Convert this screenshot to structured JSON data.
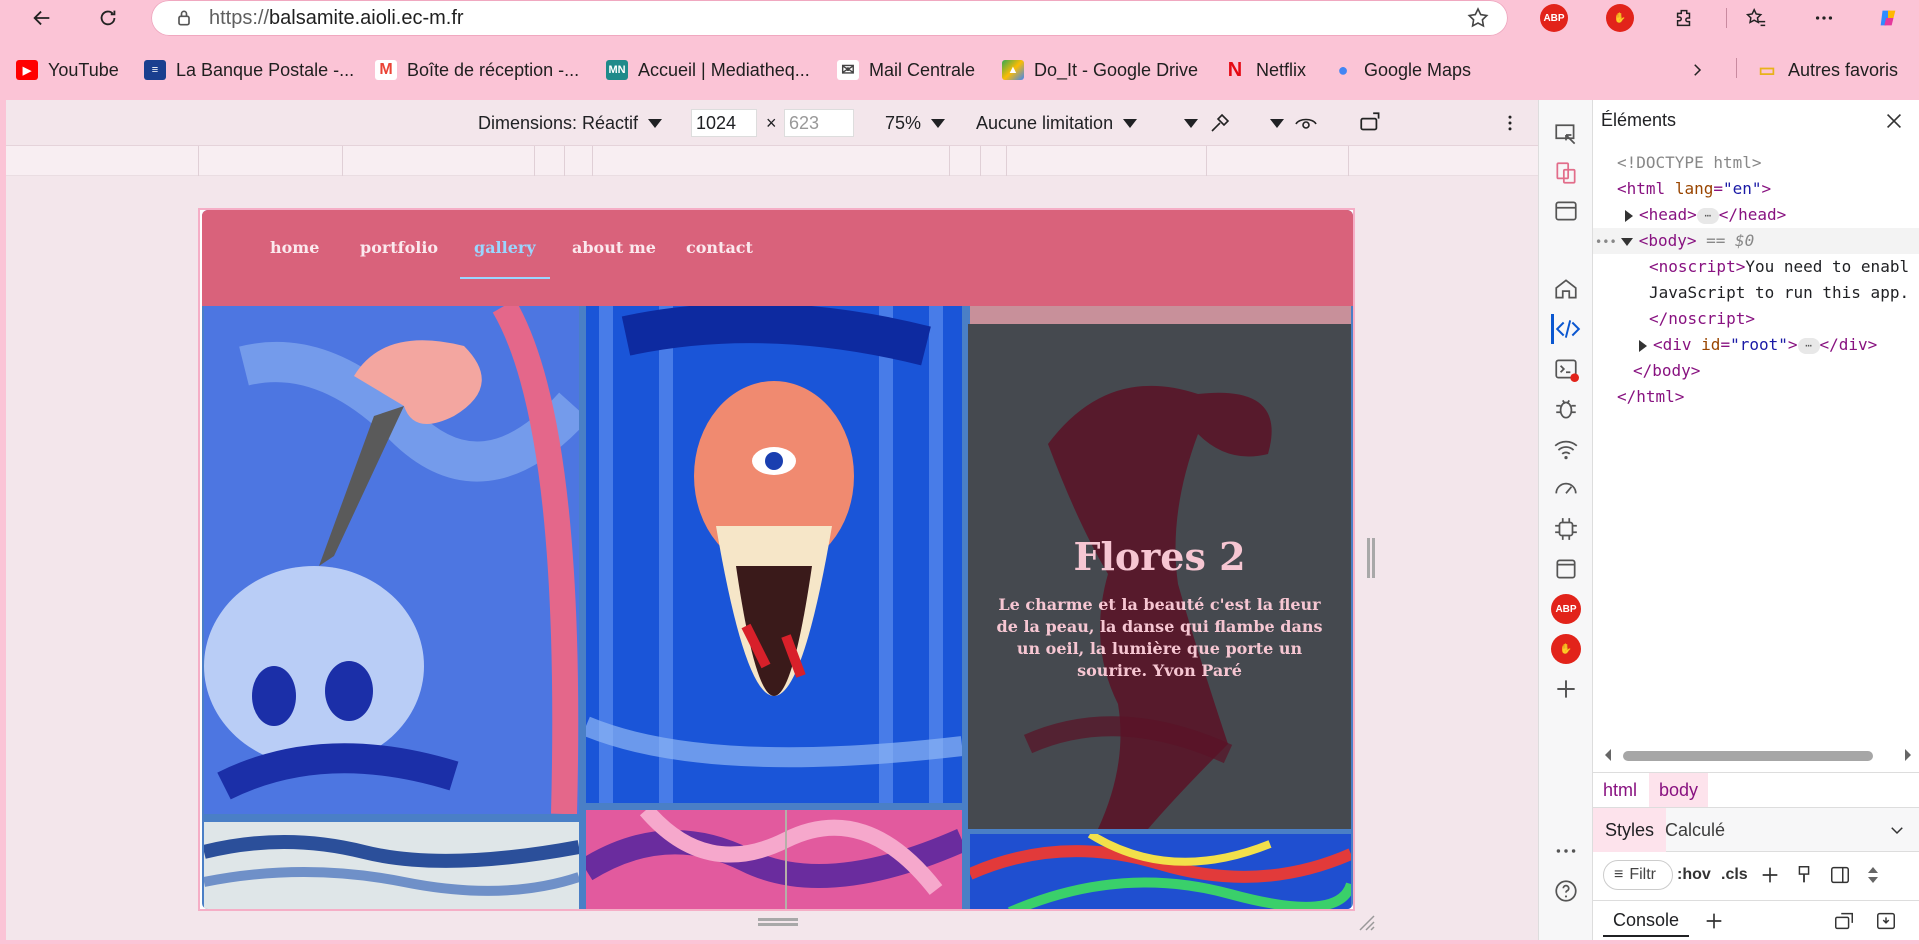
{
  "browser": {
    "url_protocol": "https://",
    "url_host": "balsamite.aioli.ec-m.fr",
    "bookmarks": [
      {
        "label": "YouTube",
        "icon": "youtube-icon",
        "color": "#ff0000"
      },
      {
        "label": "La Banque Postale -...",
        "icon": "bank-icon",
        "color": "#1a3f8f"
      },
      {
        "label": "Boîte de réception -...",
        "icon": "gmail-icon",
        "color": "#ea4335"
      },
      {
        "label": "Accueil | Mediatheq...",
        "icon": "mn-icon",
        "color": "#1f8a8a",
        "badge": "MN"
      },
      {
        "label": "Mail Centrale",
        "icon": "mail-icon",
        "color": "#444444"
      },
      {
        "label": "Do_It - Google Drive",
        "icon": "drive-icon",
        "color": "#34a853"
      },
      {
        "label": "Netflix",
        "icon": "netflix-icon",
        "color": "#e50914",
        "badge": "N"
      },
      {
        "label": "Google Maps",
        "icon": "maps-icon",
        "color": "#4285f4"
      }
    ],
    "other_favorites": "Autres favoris"
  },
  "device_toolbar": {
    "dimensions": "Dimensions: Réactif",
    "width": "1024",
    "height": "623",
    "times": "×",
    "zoom": "75%",
    "throttle": "Aucune limitation"
  },
  "site": {
    "nav": [
      {
        "label": "home"
      },
      {
        "label": "portfolio"
      },
      {
        "label": "gallery",
        "active": true
      },
      {
        "label": "about me"
      },
      {
        "label": "contact"
      }
    ],
    "card_title": "Flores 2",
    "card_text": "Le charme et la beauté c'est la fleur de la peau, la danse qui flambe dans un oeil, la lumière que porte un sourire. Yvon Paré"
  },
  "devtools": {
    "panel_title": "Éléments",
    "code": {
      "doctype": "<!DOCTYPE html>",
      "html_open": "<html",
      "lang_attr": "lang",
      "lang_val": "\"en\"",
      "gt": ">",
      "head_open": "<head>",
      "head_close": "</head>",
      "body_open": "<body>",
      "body_eq": "== $0",
      "noscript_open": "<noscript>",
      "noscript_text1": "You need to enabl",
      "noscript_text2": "JavaScript to run this app.",
      "noscript_close": "</noscript>",
      "div_open": "<div",
      "id_attr": "id",
      "id_val": "\"root\"",
      "div_close": "</div>",
      "body_close": "</body>",
      "html_close": "</html>",
      "ellipsis": "⋯",
      "dots": "•••"
    },
    "crumbs": [
      "html",
      "body"
    ],
    "style_tabs": [
      "Styles",
      "Calculé"
    ],
    "filter": "Filtr",
    "hov": ":hov",
    "cls": ".cls",
    "console": "Console"
  }
}
